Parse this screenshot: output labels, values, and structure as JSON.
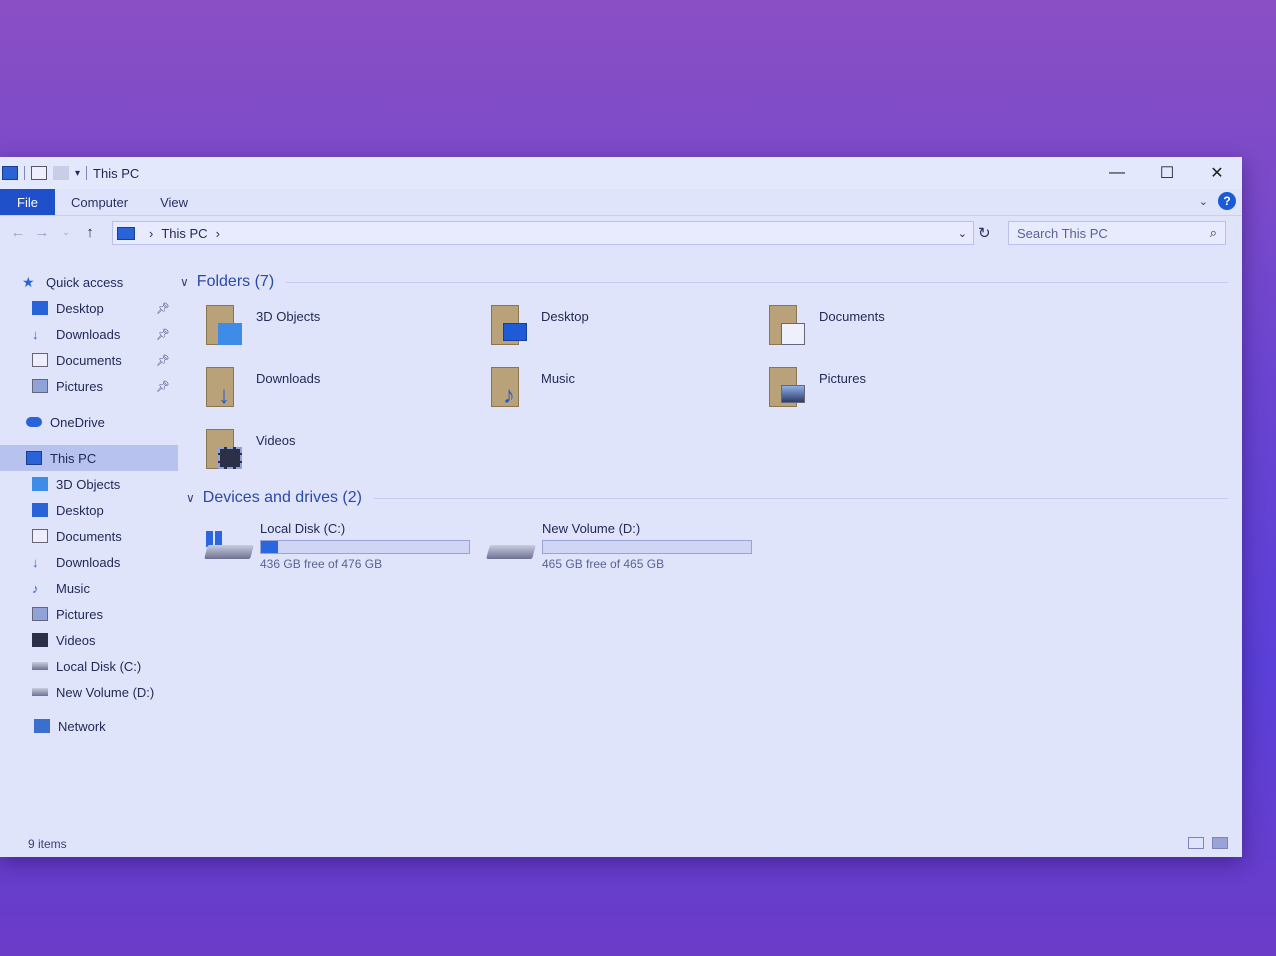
{
  "window": {
    "title": "This PC",
    "controls": {
      "minimize": "—",
      "maximize": "☐",
      "close": "✕"
    }
  },
  "ribbon": {
    "file": "File",
    "tabs": [
      "Computer",
      "View"
    ],
    "help": "?"
  },
  "address": {
    "path": "This PC",
    "search_placeholder": "Search This PC"
  },
  "sidebar": {
    "quick_access": "Quick access",
    "quick_items": [
      "Desktop",
      "Downloads",
      "Documents",
      "Pictures"
    ],
    "onedrive": "OneDrive",
    "this_pc": "This PC",
    "pc_items": [
      "3D Objects",
      "Desktop",
      "Documents",
      "Downloads",
      "Music",
      "Pictures",
      "Videos",
      "Local Disk (C:)",
      "New Volume (D:)"
    ],
    "network": "Network"
  },
  "content": {
    "folders_header": "Folders (7)",
    "folders": [
      "3D Objects",
      "Desktop",
      "Documents",
      "Downloads",
      "Music",
      "Pictures",
      "Videos"
    ],
    "drives_header": "Devices and drives (2)",
    "drives": [
      {
        "name": "Local Disk (C:)",
        "free": "436 GB free of 476 GB",
        "used_fraction": 0.084
      },
      {
        "name": "New Volume (D:)",
        "free": "465 GB free of 465 GB",
        "used_fraction": 0.0
      }
    ]
  },
  "status": {
    "items": "9 items"
  },
  "colors": {
    "accent": "#1f4fc9",
    "drive_fill": "#2a66e0"
  }
}
